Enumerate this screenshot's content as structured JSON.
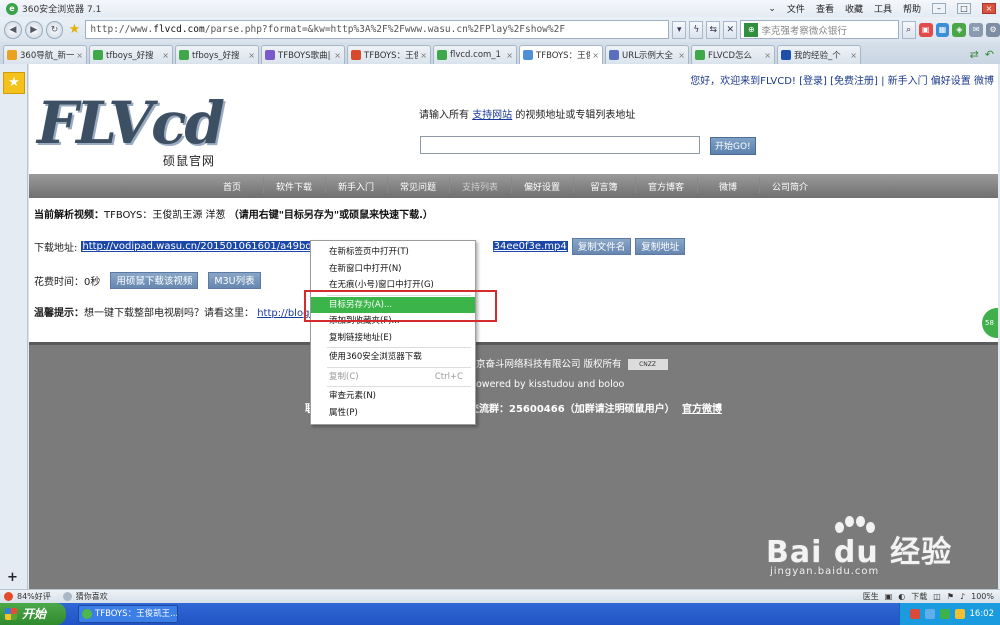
{
  "window": {
    "title": "360安全浏览器 7.1",
    "menus": [
      "文件",
      "查看",
      "收藏",
      "工具",
      "帮助"
    ]
  },
  "navbar": {
    "url_prefix": "http://www.",
    "url_domain": "flvcd.com",
    "url_rest": "/parse.php?format=&kw=http%3A%2F%2Fwww.wasu.cn%2FPlay%2Fshow%2F",
    "search_text": "李克强考察微众银行"
  },
  "tabs": [
    {
      "label": "360导航_新一",
      "color": "#e7a321"
    },
    {
      "label": "tfboys_好搜",
      "color": "#3fa84a"
    },
    {
      "label": "tfboys_好搜",
      "color": "#3fa84a"
    },
    {
      "label": "TFBOYS歌曲|",
      "color": "#7a59c9"
    },
    {
      "label": "TFBOYS：王俊",
      "color": "#d94a2b"
    },
    {
      "label": "flvcd.com_1",
      "color": "#3fa84a"
    },
    {
      "label": "TFBOYS：王俊",
      "color": "#4e8fd6",
      "active": true
    },
    {
      "label": "URL示例大全",
      "color": "#5a6fbf"
    },
    {
      "label": "FLVCD怎么",
      "color": "#3fa84a"
    },
    {
      "label": "我的经验_个",
      "color": "#1e4fa8"
    }
  ],
  "site": {
    "topnav": "您好，欢迎来到FLVCD! [登录] [免费注册] | 新手入门  偏好设置  微博",
    "logo_text": "FLVcd",
    "logo_sub": "硕鼠官网",
    "prompt_before": "请输入所有",
    "prompt_link": "支持网站",
    "prompt_after": "的视频地址或专辑列表地址",
    "go_label": "开始GO!",
    "menu": [
      "首页",
      "软件下载",
      "新手入门",
      "常见问题",
      "支持列表",
      "偏好设置",
      "留言簿",
      "官方博客",
      "微博",
      "公司简介"
    ],
    "parsing_label": "当前解析视频：",
    "parsing_title": "TFBOYS：王俊凯王源 洋葱",
    "parsing_hint": "（请用右键\"目标另存为\"或硕鼠来快速下载.）",
    "download_label": "下载地址:",
    "download_link_a": "http://vodipad.wasu.cn/201501061601/a49bd1e06b0",
    "download_link_b": "34ee0f3e.mp4",
    "copy_name": "复制文件名",
    "copy_addr": "复制地址",
    "time_label": "花费时间：0秒",
    "btn_download_shuoshu": "用硕鼠下载该视频",
    "btn_m3u": "M3U列表",
    "tip_label": "温馨提示：",
    "tip_text": "想一键下载整部电视剧吗？请看这里：",
    "tip_link": "http://blog.flv",
    "footer1": "京奋斗网络科技有限公司 版权所有",
    "footer1_badge": "CNZZ",
    "footer2": "owered by kisstudou and boloo",
    "footer3a": "联",
    "footer3b": "交流群：25600466（加群请注明硕鼠用户）",
    "footer3c": "官方微博",
    "bubble": "58"
  },
  "context_menu": [
    {
      "label": "在新标签页中打开(T)"
    },
    {
      "label": "在新窗口中打开(N)"
    },
    {
      "label": "在无痕(小号)窗口中打开(G)"
    },
    {
      "sep": true
    },
    {
      "label": "目标另存为(A)...",
      "highlight": true
    },
    {
      "label": "添加到收藏夹(F)..."
    },
    {
      "label": "复制链接地址(E)"
    },
    {
      "sep": true
    },
    {
      "label": "使用360安全浏览器下载"
    },
    {
      "sep": true
    },
    {
      "label": "复制(C)",
      "accel": "Ctrl+C",
      "disabled": true
    },
    {
      "sep": true
    },
    {
      "label": "审查元素(N)"
    },
    {
      "label": "属性(P)"
    }
  ],
  "status": {
    "rating": "84%好评",
    "guess": "猜你喜欢",
    "right_items": [
      "医生",
      "",
      "",
      "下载",
      "",
      "",
      "",
      "100%"
    ]
  },
  "taskbar": {
    "start": "开始",
    "task": "TFBOYS：王俊凯王...",
    "clock": "16:02"
  },
  "watermark": {
    "main": "Bai du 经验",
    "sub": "jingyan.baidu.com"
  }
}
